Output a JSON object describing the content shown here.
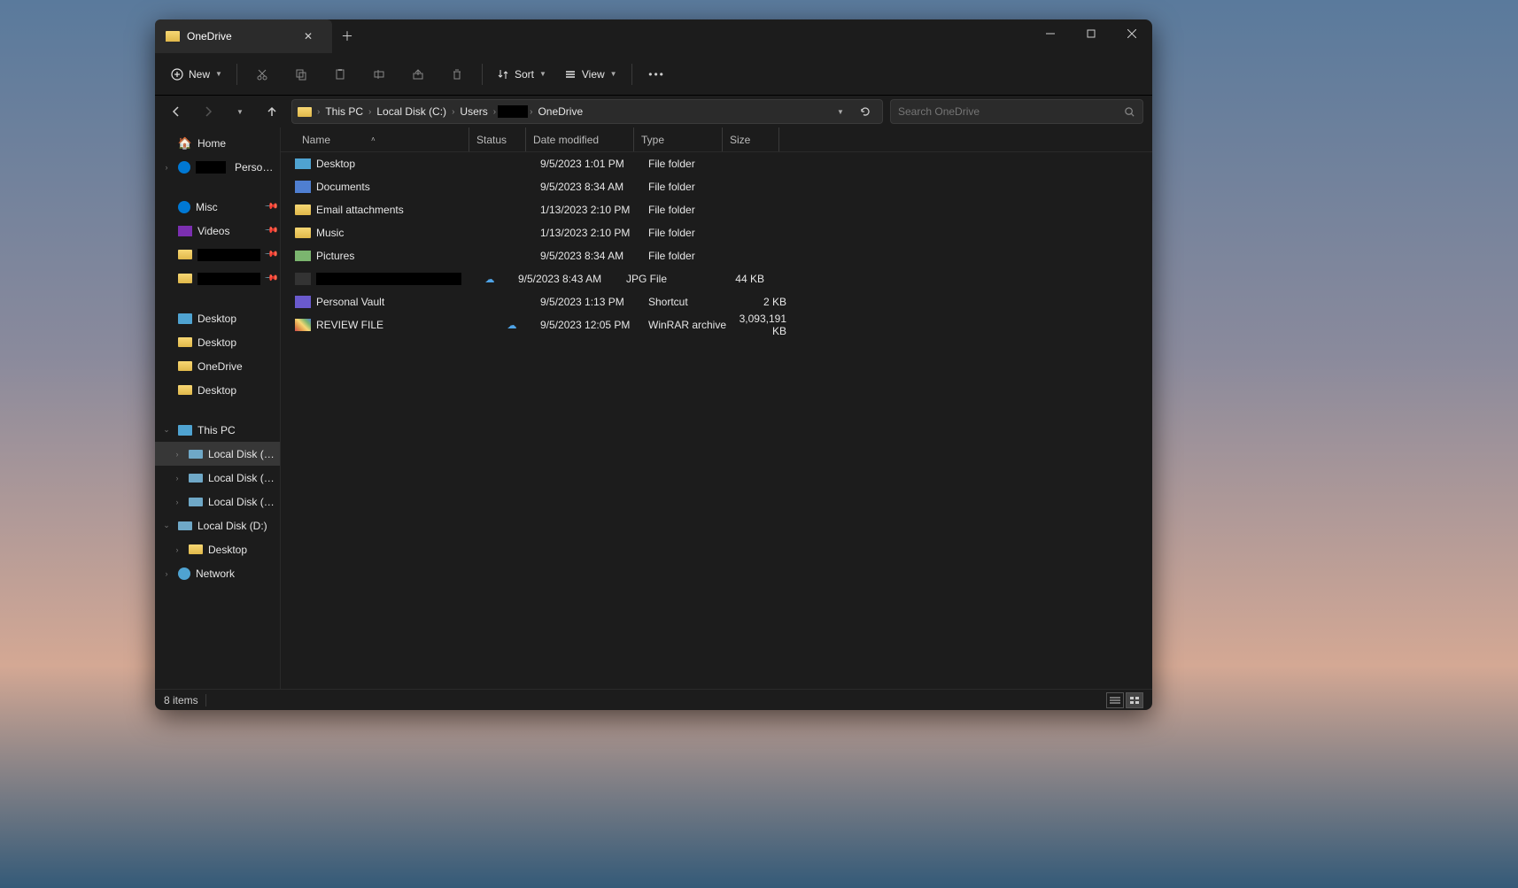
{
  "tab": {
    "title": "OneDrive"
  },
  "toolbar": {
    "new_label": "New",
    "sort_label": "Sort",
    "view_label": "View"
  },
  "breadcrumbs": [
    "This PC",
    "Local Disk (C:)",
    "Users",
    "",
    "OneDrive"
  ],
  "search": {
    "placeholder": "Search OneDrive"
  },
  "columns": {
    "name": "Name",
    "status": "Status",
    "date": "Date modified",
    "type": "Type",
    "size": "Size"
  },
  "sidebar": {
    "home": "Home",
    "personal": "Personal",
    "quick": [
      {
        "label": "Misc",
        "icon": "misc"
      },
      {
        "label": "Videos",
        "icon": "vid"
      },
      {
        "label": "",
        "icon": "folder",
        "redacted": true
      },
      {
        "label": "",
        "icon": "folder",
        "redacted": true
      }
    ],
    "folders": [
      {
        "label": "Desktop",
        "icon": "desktop"
      },
      {
        "label": "Desktop",
        "icon": "folder"
      },
      {
        "label": "OneDrive",
        "icon": "folder"
      },
      {
        "label": "Desktop",
        "icon": "folder"
      }
    ],
    "thispc": "This PC",
    "drives": [
      {
        "label": "Local Disk (C:)",
        "selected": true
      },
      {
        "label": "Local Disk (D:)"
      },
      {
        "label": "Local Disk (E:)"
      }
    ],
    "drive_d_expanded": "Local Disk (D:)",
    "drive_d_child": "Desktop",
    "network": "Network"
  },
  "files": [
    {
      "name": "Desktop",
      "icon": "desktop",
      "status": "",
      "date": "9/5/2023 1:01 PM",
      "type": "File folder",
      "size": ""
    },
    {
      "name": "Documents",
      "icon": "doc",
      "status": "",
      "date": "9/5/2023 8:34 AM",
      "type": "File folder",
      "size": ""
    },
    {
      "name": "Email attachments",
      "icon": "folder",
      "status": "",
      "date": "1/13/2023 2:10 PM",
      "type": "File folder",
      "size": ""
    },
    {
      "name": "Music",
      "icon": "folder",
      "status": "",
      "date": "1/13/2023 2:10 PM",
      "type": "File folder",
      "size": ""
    },
    {
      "name": "Pictures",
      "icon": "pic",
      "status": "",
      "date": "9/5/2023 8:34 AM",
      "type": "File folder",
      "size": ""
    },
    {
      "name": "",
      "icon": "img",
      "status": "☁",
      "date": "9/5/2023 8:43 AM",
      "type": "JPG File",
      "size": "44 KB",
      "redacted": true
    },
    {
      "name": "Personal Vault",
      "icon": "vault",
      "status": "",
      "date": "9/5/2023 1:13 PM",
      "type": "Shortcut",
      "size": "2 KB"
    },
    {
      "name": "REVIEW FILE",
      "icon": "rar",
      "status": "☁",
      "date": "9/5/2023 12:05 PM",
      "type": "WinRAR archive",
      "size": "3,093,191 KB"
    }
  ],
  "status": {
    "count": "8 items"
  }
}
